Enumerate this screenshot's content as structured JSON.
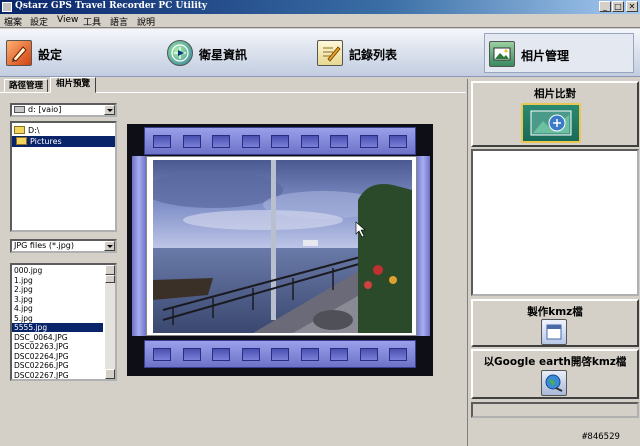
{
  "window": {
    "title": "Qstarz GPS Travel Recorder PC Utility",
    "minimize": "_",
    "maximize": "□",
    "close": "✕"
  },
  "menu": [
    "檔案",
    "設定",
    "View",
    "工具",
    "語言",
    "說明"
  ],
  "toolbar": {
    "settings": "設定",
    "satellite": "衛星資訊",
    "records": "記錄列表",
    "photos": "相片管理"
  },
  "tabs": {
    "route": "路徑管理",
    "preview": "相片預覽"
  },
  "drive_select": {
    "value": "d: [vaio]"
  },
  "folder_tree": [
    {
      "label": "D:\\",
      "selected": false
    },
    {
      "label": "Pictures",
      "selected": true
    }
  ],
  "filter_select": {
    "value": "JPG files (*.jpg)"
  },
  "file_list": [
    "000.jpg",
    "1.jpg",
    "2.jpg",
    "3.jpg",
    "4.jpg",
    "5.jpg",
    "5555.jpg",
    "DSC_0064.JPG",
    "DSC02263.JPG",
    "DSC02264.JPG",
    "DSC02266.JPG",
    "DSC02267.JPG"
  ],
  "file_selected_index": 6,
  "right_panel": {
    "compare_label": "相片比對",
    "kmz_label": "製作kmz檔",
    "google_label": "以Google earth開啓kmz檔"
  },
  "icons": {
    "settings": "edit-icon",
    "satellite": "globe-icon",
    "records": "notepad-icon",
    "photos": "photo-manager-icon",
    "compare": "photo-compare-icon",
    "kmz": "document-icon",
    "google": "google-earth-icon"
  },
  "watermark": "#846529"
}
